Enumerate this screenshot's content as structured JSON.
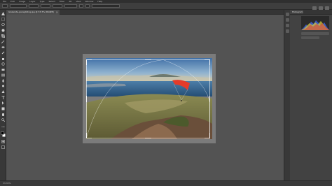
{
  "menubar": {
    "items": [
      "File",
      "Edit",
      "Image",
      "Layer",
      "Type",
      "Select",
      "Filter",
      "3D",
      "View",
      "Window",
      "Help"
    ]
  },
  "options": {
    "ratio_label": "Ratio",
    "clear_label": "Clear",
    "straighten_label": "Straighten",
    "delete_pixels_label": "Delete Cropped Pixels"
  },
  "document": {
    "tab_title": "lanzarote-paragliding.jpg @ 33.3% (RGB/8)",
    "close_glyph": "×"
  },
  "panel": {
    "title": "Histogram"
  },
  "status": {
    "zoom": "33.33%"
  },
  "colors": {
    "canopy": "#e53b2a",
    "sky_top": "#4a7fb5",
    "sea": "#2f5f8a",
    "hills": "#9a8a55"
  }
}
